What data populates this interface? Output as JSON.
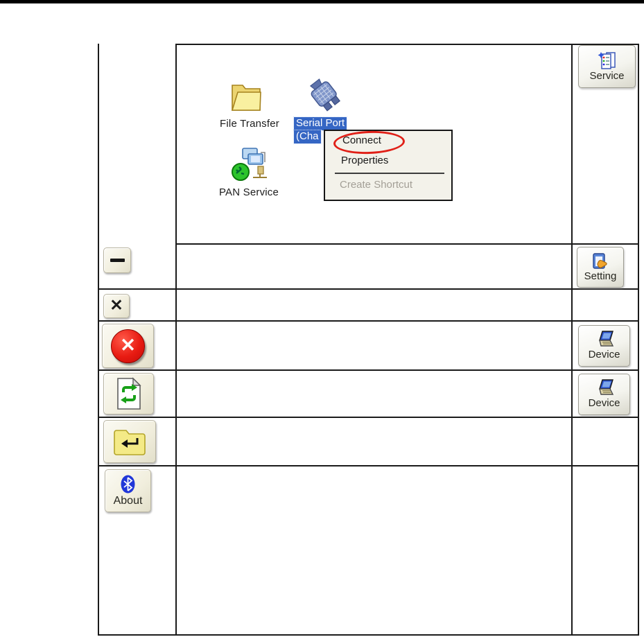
{
  "colors": {
    "selection_blue": "#3566c4",
    "menu_bg": "#f3f2ea",
    "annotation_red": "#e02017",
    "folder_yellow": "#f4ea87",
    "bluetooth_blue": "#2137d8",
    "arrow_green": "#18a018"
  },
  "icons": {
    "close_glyph": "✕",
    "error_glyph": "✕"
  },
  "desktop_icons": {
    "file_transfer": {
      "label": "File Transfer"
    },
    "serial_port": {
      "label_line1": "Serial Port",
      "label_line2": "(Cha"
    },
    "pan_service": {
      "label": "PAN Service"
    }
  },
  "context_menu": {
    "items": [
      {
        "label": "Connect",
        "annotated": "circled-red"
      },
      {
        "label": "Properties"
      },
      {
        "label": "Create Shortcut",
        "state": "disabled"
      }
    ]
  },
  "left_toolbar": {
    "about": {
      "label": "About"
    }
  },
  "right_toolbar": [
    {
      "label": "Service"
    },
    {
      "label": "Setting"
    },
    {
      "label": "Device"
    },
    {
      "label": "Device"
    }
  ]
}
